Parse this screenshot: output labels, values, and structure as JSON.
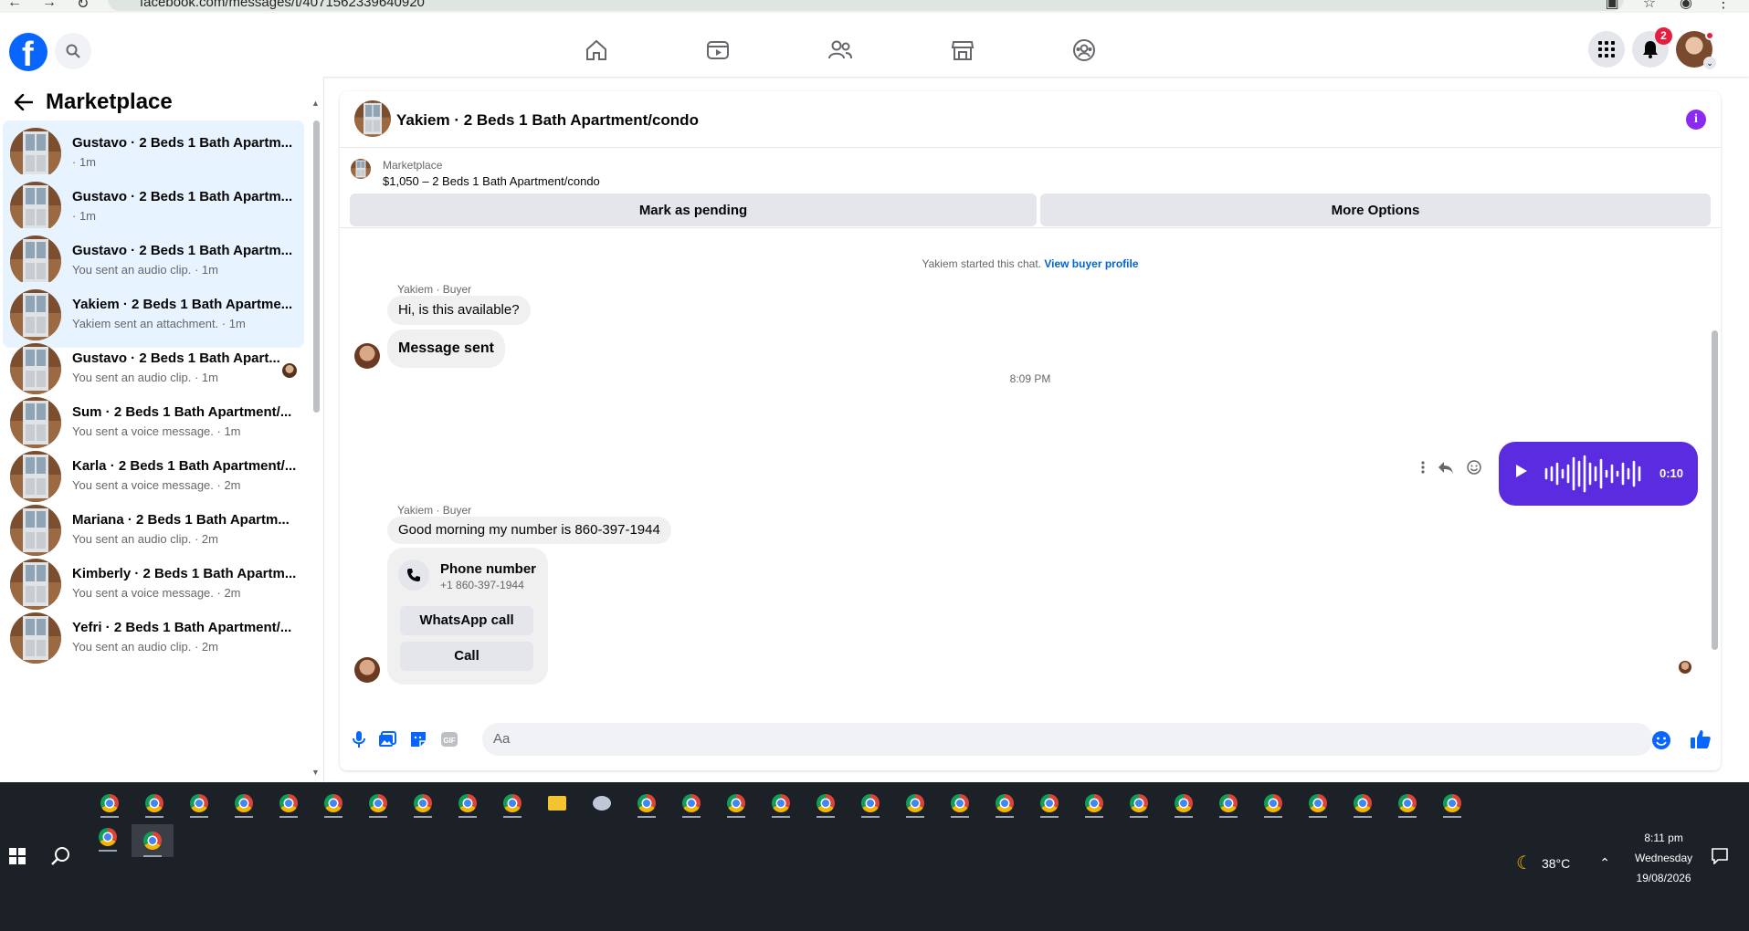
{
  "browser": {
    "url": "facebook.com/messages/t/4071562339640920"
  },
  "header": {
    "logo": "f",
    "notification_count": "2"
  },
  "sidebar": {
    "title": "Marketplace",
    "conversations": [
      {
        "name": "Gustavo · 2 Beds 1 Bath Apartm...",
        "sub": " · 1m",
        "active": true
      },
      {
        "name": "Gustavo · 2 Beds 1 Bath Apartm...",
        "sub": " · 1m",
        "active": true
      },
      {
        "name": "Gustavo · 2 Beds 1 Bath Apartm...",
        "sub": "You sent an audio clip. · 1m",
        "active": true
      },
      {
        "name": "Yakiem · 2 Beds 1 Bath Apartme...",
        "sub": "Yakiem sent an attachment. · 1m",
        "active": true
      },
      {
        "name": "Gustavo · 2 Beds 1 Bath Apart...",
        "sub": "You sent an audio clip. · 1m",
        "active": false
      },
      {
        "name": "Sum · 2 Beds 1 Bath Apartment/...",
        "sub": "You sent a voice message. · 1m",
        "active": false
      },
      {
        "name": "Karla · 2 Beds 1 Bath Apartment/...",
        "sub": "You sent a voice message. · 2m",
        "active": false
      },
      {
        "name": "Mariana · 2 Beds 1 Bath Apartm...",
        "sub": "You sent an audio clip. · 2m",
        "active": false
      },
      {
        "name": "Kimberly · 2 Beds 1 Bath Apartm...",
        "sub": "You sent a voice message. · 2m",
        "active": false
      },
      {
        "name": "Yefri · 2 Beds 1 Bath Apartment/...",
        "sub": "You sent an audio clip. · 2m",
        "active": false
      }
    ]
  },
  "chat": {
    "title": "Yakiem · 2 Beds 1 Bath Apartment/condo",
    "listing_category": "Marketplace",
    "listing_price": "$1,050 – 2 Beds 1 Bath Apartment/condo",
    "btn_pending": "Mark as pending",
    "btn_more": "More Options",
    "started_text": "Yakiem started this chat.",
    "view_profile": "View buyer profile",
    "sender1": "Yakiem · Buyer",
    "msg1": "Hi, is this available?",
    "msg2": "Message sent",
    "timestamp": "8:09 PM",
    "audio_duration": "0:10",
    "sender2": "Yakiem · Buyer",
    "msg3": "Good morning my number is 860-397-1944",
    "phone_title": "Phone number",
    "phone_number": "+1 860-397-1944",
    "btn_whatsapp": "WhatsApp call",
    "btn_call": "Call",
    "composer_placeholder": "Aa"
  },
  "taskbar": {
    "temperature": "38°C",
    "time": "8:11 pm",
    "day": "Wednesday",
    "date": "19/08/2026"
  },
  "colors": {
    "fb_blue": "#0866ff",
    "audio_purple": "#5b2be0",
    "active_conv": "#e7f3ff"
  }
}
